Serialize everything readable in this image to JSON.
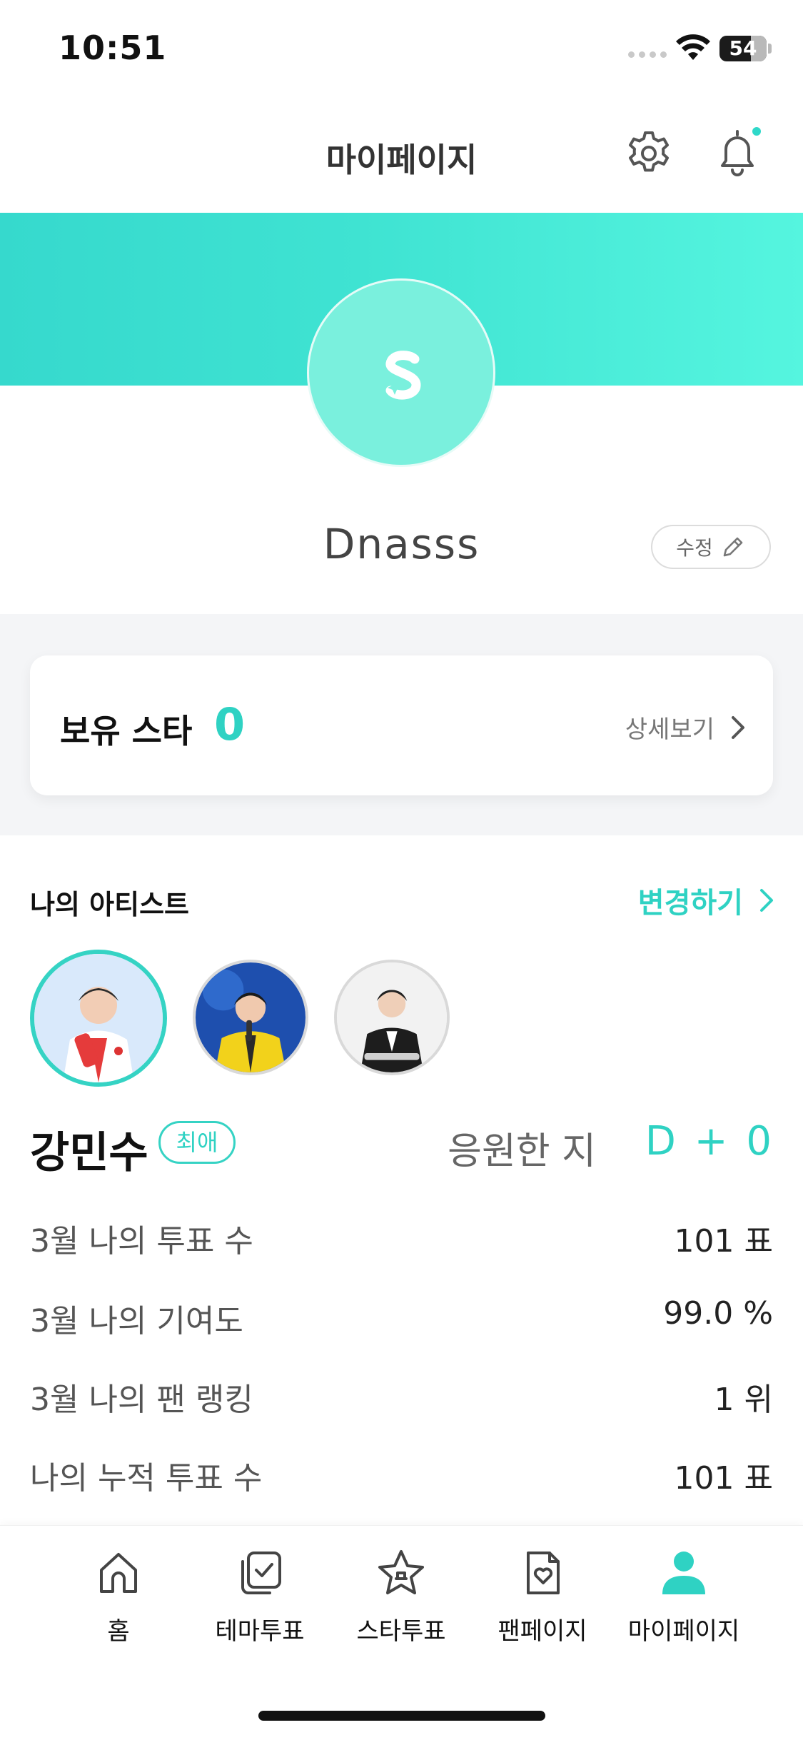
{
  "status_bar": {
    "time": "10:51",
    "battery": "54"
  },
  "header": {
    "title": "마이페이지"
  },
  "profile": {
    "username": "Dnasss",
    "edit_label": "수정"
  },
  "stars": {
    "label": "보유 스타",
    "count": "0",
    "detail_label": "상세보기"
  },
  "artists": {
    "section_title": "나의 아티스트",
    "change_label": "변경하기",
    "selected_name": "강민수",
    "favorite_badge": "최애",
    "support_label": "응원한 지",
    "support_value": "D + 0"
  },
  "stats": [
    {
      "label": "3월 나의 투표 수",
      "value": "101 표"
    },
    {
      "label": "3월 나의 기여도",
      "value": "99.0 %"
    },
    {
      "label": "3월 나의 팬 랭킹",
      "value": "1 위"
    },
    {
      "label": "나의 누적 투표 수",
      "value": "101 표"
    }
  ],
  "tabs": [
    {
      "label": "홈",
      "icon": "home-icon"
    },
    {
      "label": "테마투표",
      "icon": "theme-vote-icon"
    },
    {
      "label": "스타투표",
      "icon": "star-vote-icon"
    },
    {
      "label": "팬페이지",
      "icon": "fan-page-icon"
    },
    {
      "label": "마이페이지",
      "icon": "my-page-icon",
      "active": true
    }
  ],
  "colors": {
    "accent": "#2fd2c3",
    "banner_start": "#36d9cd",
    "banner_end": "#55f5df"
  }
}
